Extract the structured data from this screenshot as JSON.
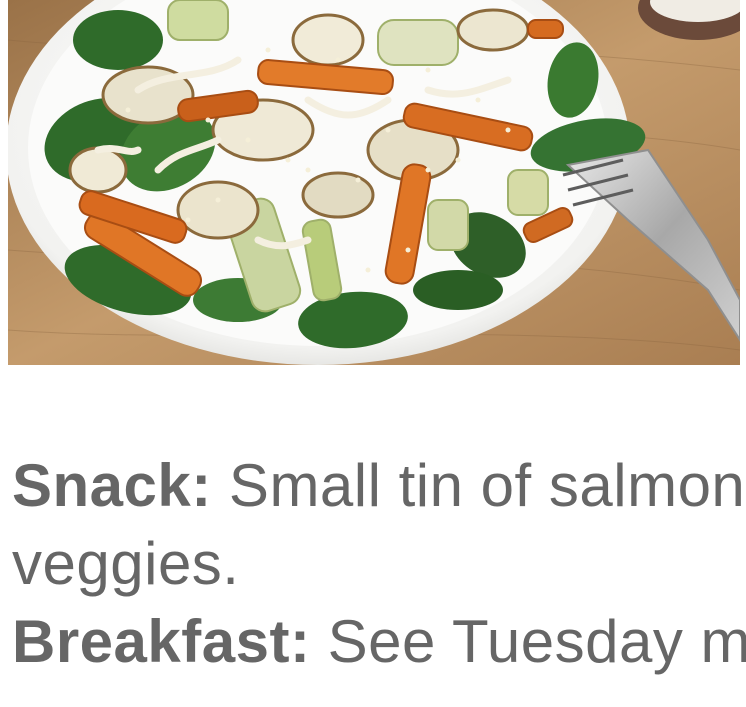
{
  "photo": {
    "icon": "salad-photo"
  },
  "meals": [
    {
      "label": "Snack:",
      "text": " Small tin of salmon"
    },
    {
      "label": "",
      "text": "veggies."
    },
    {
      "label": "Breakfast:",
      "text": " See Tuesday m"
    }
  ],
  "colors": {
    "text": "#666666",
    "background": "#ffffff"
  }
}
